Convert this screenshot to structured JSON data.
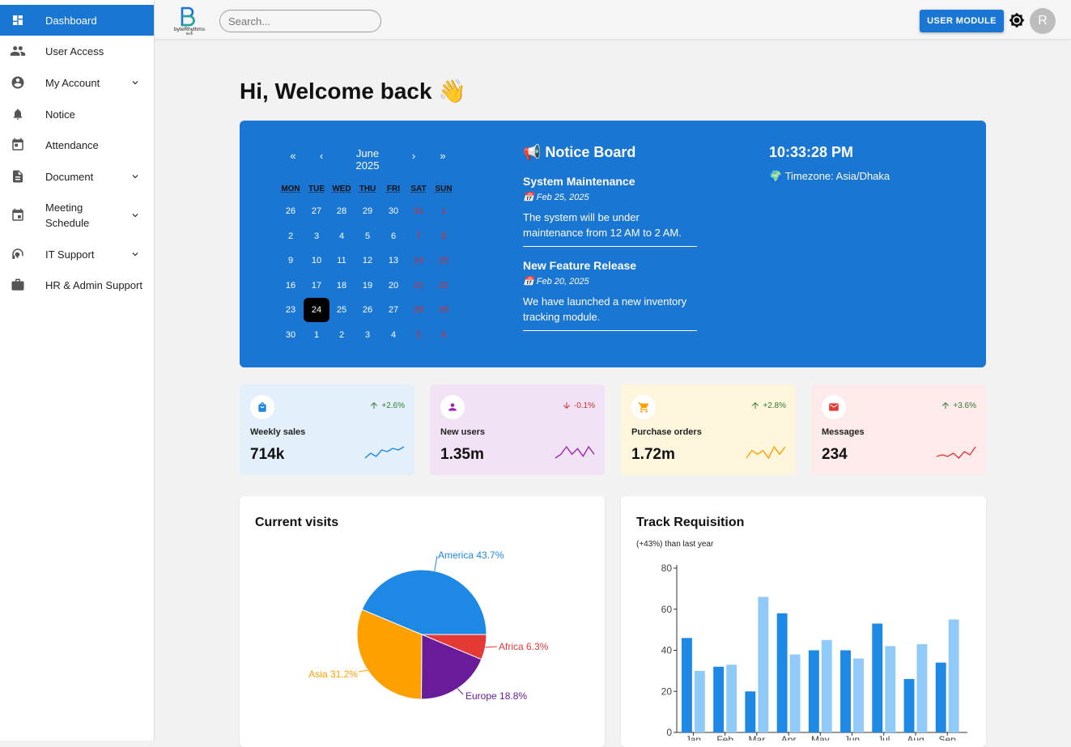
{
  "sidebar": {
    "items": [
      {
        "label": "Dashboard",
        "icon": "dashboard-icon",
        "active": true
      },
      {
        "label": "User Access",
        "icon": "people-icon"
      },
      {
        "label": "My Account",
        "icon": "account-circle-icon",
        "expandable": true
      },
      {
        "label": "Notice",
        "icon": "bell-icon"
      },
      {
        "label": "Attendance",
        "icon": "calendar-icon"
      },
      {
        "label": "Document",
        "icon": "document-icon",
        "expandable": true
      },
      {
        "label": "Meeting Schedule",
        "icon": "event-icon",
        "expandable": true
      },
      {
        "label": "IT Support",
        "icon": "headset-icon",
        "expandable": true
      },
      {
        "label": "HR & Admin Support",
        "icon": "briefcase-icon"
      }
    ]
  },
  "topbar": {
    "logo_text": "byteRhythms tech",
    "search_placeholder": "Search...",
    "user_module_label": "USER MODULE",
    "avatar_initial": "R"
  },
  "welcome": "Hi, Welcome back 👋",
  "calendar": {
    "prev_year": "«",
    "prev_month": "‹",
    "next_month": "›",
    "next_year": "»",
    "month": "June",
    "year": "2025",
    "weekdays": [
      "MON",
      "TUE",
      "WED",
      "THU",
      "FRI",
      "SAT",
      "SUN"
    ],
    "weeks": [
      [
        "26",
        "27",
        "28",
        "29",
        "30",
        "31",
        "1"
      ],
      [
        "2",
        "3",
        "4",
        "5",
        "6",
        "7",
        "8"
      ],
      [
        "9",
        "10",
        "11",
        "12",
        "13",
        "14",
        "15"
      ],
      [
        "16",
        "17",
        "18",
        "19",
        "20",
        "21",
        "22"
      ],
      [
        "23",
        "24",
        "25",
        "26",
        "27",
        "28",
        "29"
      ],
      [
        "30",
        "1",
        "2",
        "3",
        "4",
        "5",
        "6"
      ]
    ],
    "selected": "24",
    "weekend_color": "#d32f2f"
  },
  "notice_board": {
    "title": "📢 Notice Board",
    "items": [
      {
        "title": "System Maintenance",
        "date": "📅 Feb 25, 2025",
        "body": "The system will be under maintenance from 12 AM to 2 AM."
      },
      {
        "title": "New Feature Release",
        "date": "📅 Feb 20, 2025",
        "body": "We have launched a new inventory tracking module."
      }
    ]
  },
  "clock": {
    "time": "10:33:28 PM",
    "timezone": "🌍 Timezone: Asia/Dhaka"
  },
  "stats": [
    {
      "label": "Weekly sales",
      "value": "714k",
      "trend": "+2.6%",
      "direction": "up",
      "icon": "shopping-bag-icon",
      "bg": "#e3f0fc",
      "color": "#1e88e5",
      "spark": [
        6,
        9,
        7,
        11,
        10,
        12,
        11,
        13
      ]
    },
    {
      "label": "New users",
      "value": "1.35m",
      "trend": "-0.1%",
      "direction": "down",
      "icon": "person-icon",
      "bg": "#f1e2f5",
      "color": "#9c27b0",
      "spark": [
        6,
        8,
        12,
        8,
        11,
        7,
        12,
        8
      ]
    },
    {
      "label": "Purchase orders",
      "value": "1.72m",
      "trend": "+2.8%",
      "direction": "up",
      "icon": "cart-icon",
      "bg": "#fef6dc",
      "color": "#ffa000",
      "spark": [
        8,
        10,
        9,
        10,
        8,
        11,
        9,
        11
      ]
    },
    {
      "label": "Messages",
      "value": "234",
      "trend": "+3.6%",
      "direction": "up",
      "icon": "mail-icon",
      "bg": "#fdeaea",
      "color": "#e53935",
      "spark": [
        6,
        7,
        6,
        8,
        5,
        9,
        7,
        12
      ]
    }
  ],
  "colors": {
    "primary": "#1976d2",
    "trend_up": "#2e7d32",
    "trend_down": "#d32f2f"
  },
  "visits": {
    "title": "Current visits"
  },
  "requisition": {
    "title": "Track Requisition",
    "subtitle": "(+43%) than last year"
  },
  "chart_data": [
    {
      "type": "pie",
      "title": "Current visits",
      "labels": [
        "America",
        "Africa",
        "Europe",
        "Asia"
      ],
      "values": [
        43.7,
        6.3,
        18.8,
        31.2
      ],
      "display_labels": [
        "America 43.7%",
        "Africa 6.3%",
        "Europe 18.8%",
        "Asia 31.2%"
      ],
      "colors": [
        "#1e88e5",
        "#e53935",
        "#6a1b9a",
        "#ffa000"
      ]
    },
    {
      "type": "bar",
      "title": "Track Requisition",
      "categories": [
        "Jan",
        "Feb",
        "Mar",
        "Apr",
        "May",
        "Jun",
        "Jul",
        "Aug",
        "Sep"
      ],
      "series": [
        {
          "values": [
            46,
            32,
            20,
            58,
            40,
            40,
            53,
            26,
            34
          ],
          "color": "#1e88e5"
        },
        {
          "values": [
            30,
            33,
            66,
            38,
            45,
            36,
            42,
            43,
            55
          ],
          "color": "#90caf9"
        }
      ],
      "yticks": [
        "0",
        "20",
        "40",
        "60",
        "80"
      ],
      "ylim": [
        0,
        80
      ],
      "grid": false
    }
  ]
}
